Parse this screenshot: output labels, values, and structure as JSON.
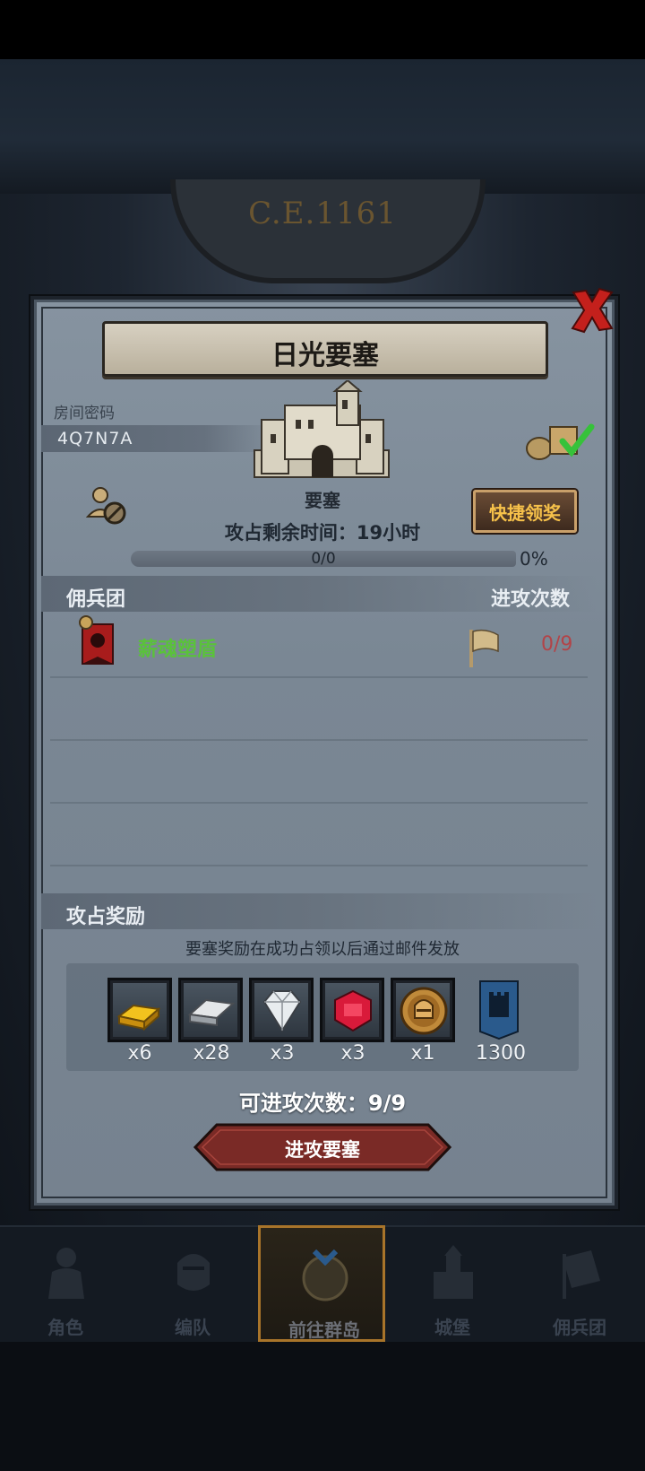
{
  "era": "C.E.1161",
  "dialog": {
    "title": "日光要塞",
    "room_code_label": "房间密码",
    "room_code": "4Q7N7A",
    "castle_label": "要塞",
    "remaining_time": "攻占剩余时间：19小时",
    "quick_claim": "快捷领奖",
    "progress_text": "0/0",
    "progress_pct": "0%",
    "mercenary_header": "佣兵团",
    "attacks_header": "进攻次数",
    "mercenaries": [
      {
        "name": "薪魂塑盾",
        "count": "0/9"
      }
    ],
    "reward_header": "攻占奖励",
    "reward_note": "要塞奖励在成功占领以后通过邮件发放",
    "rewards": [
      {
        "icon": "gold-bar-icon",
        "qty": "x6"
      },
      {
        "icon": "iron-bar-icon",
        "qty": "x28"
      },
      {
        "icon": "diamond-icon",
        "qty": "x3"
      },
      {
        "icon": "ruby-icon",
        "qty": "x3"
      },
      {
        "icon": "knight-coin-icon",
        "qty": "x1"
      },
      {
        "icon": "fortress-banner-icon",
        "qty": "1300"
      }
    ],
    "attacks_available": "可进攻次数：9/9",
    "attack_button": "进攻要塞"
  },
  "nav": [
    {
      "label": "角色",
      "icon": "character-icon"
    },
    {
      "label": "编队",
      "icon": "formation-icon"
    },
    {
      "label": "前往群岛",
      "icon": "islands-icon",
      "active": true
    },
    {
      "label": "城堡",
      "icon": "castle-icon"
    },
    {
      "label": "佣兵团",
      "icon": "mercenary-icon"
    }
  ],
  "colors": {
    "panel": "#7a8794",
    "accent_gold": "#f6c14a",
    "merc_name": "#5ac23b",
    "count_red": "#b24448",
    "button_red": "#7a2a26"
  }
}
